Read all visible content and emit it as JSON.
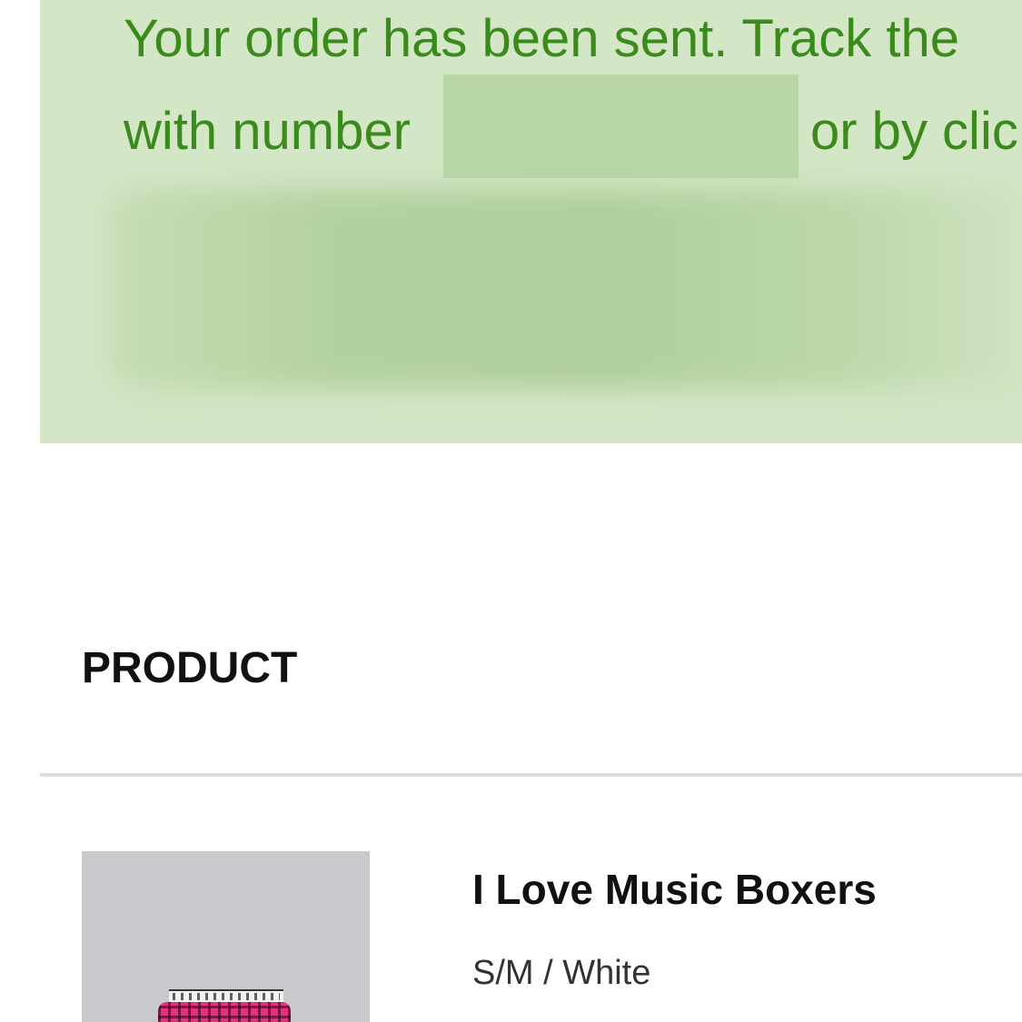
{
  "notice": {
    "line1": "Your order has been sent. Track the",
    "line2_prefix": "with number",
    "line2_suffix": "or by clic",
    "background_color": "#d3e6c6",
    "text_color": "#3a8a1c"
  },
  "product_section": {
    "title": "PRODUCT"
  },
  "product": {
    "name": "I Love Music Boxers",
    "variant": "S/M / White",
    "image_icon": "plaid-boxers-image"
  }
}
